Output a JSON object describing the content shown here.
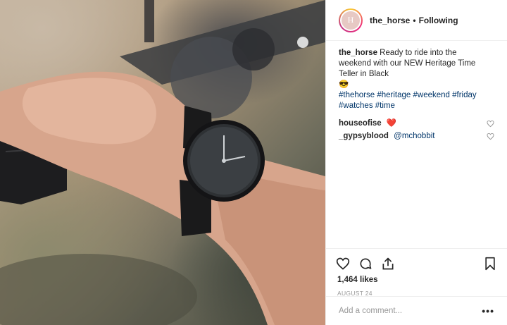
{
  "header": {
    "avatar_letter": "H",
    "username": "the_horse",
    "separator": "•",
    "follow_status": "Following"
  },
  "caption": {
    "username": "the_horse",
    "text": "Ready to ride into the weekend with our NEW Heritage Time Teller in Black",
    "emoji": "😎",
    "hashtags": "#thehorse #heritage #weekend #friday #watches #time"
  },
  "comments": [
    {
      "username": "houseofise",
      "text": "",
      "emoji": "❤️"
    },
    {
      "username": "_gypsyblood",
      "text": "@mchobbit",
      "emoji": ""
    }
  ],
  "post": {
    "likes": "1,464 likes",
    "date": "AUGUST 24"
  },
  "add_comment": {
    "placeholder": "Add a comment...",
    "more_label": "•••"
  },
  "icons": {
    "like": "heart-icon",
    "comment": "comment-icon",
    "share": "share-icon",
    "save": "bookmark-icon"
  },
  "colors": {
    "text": "#262626",
    "link": "#003569",
    "muted": "#999999",
    "border": "#efefef",
    "heart": "#ed4956"
  }
}
